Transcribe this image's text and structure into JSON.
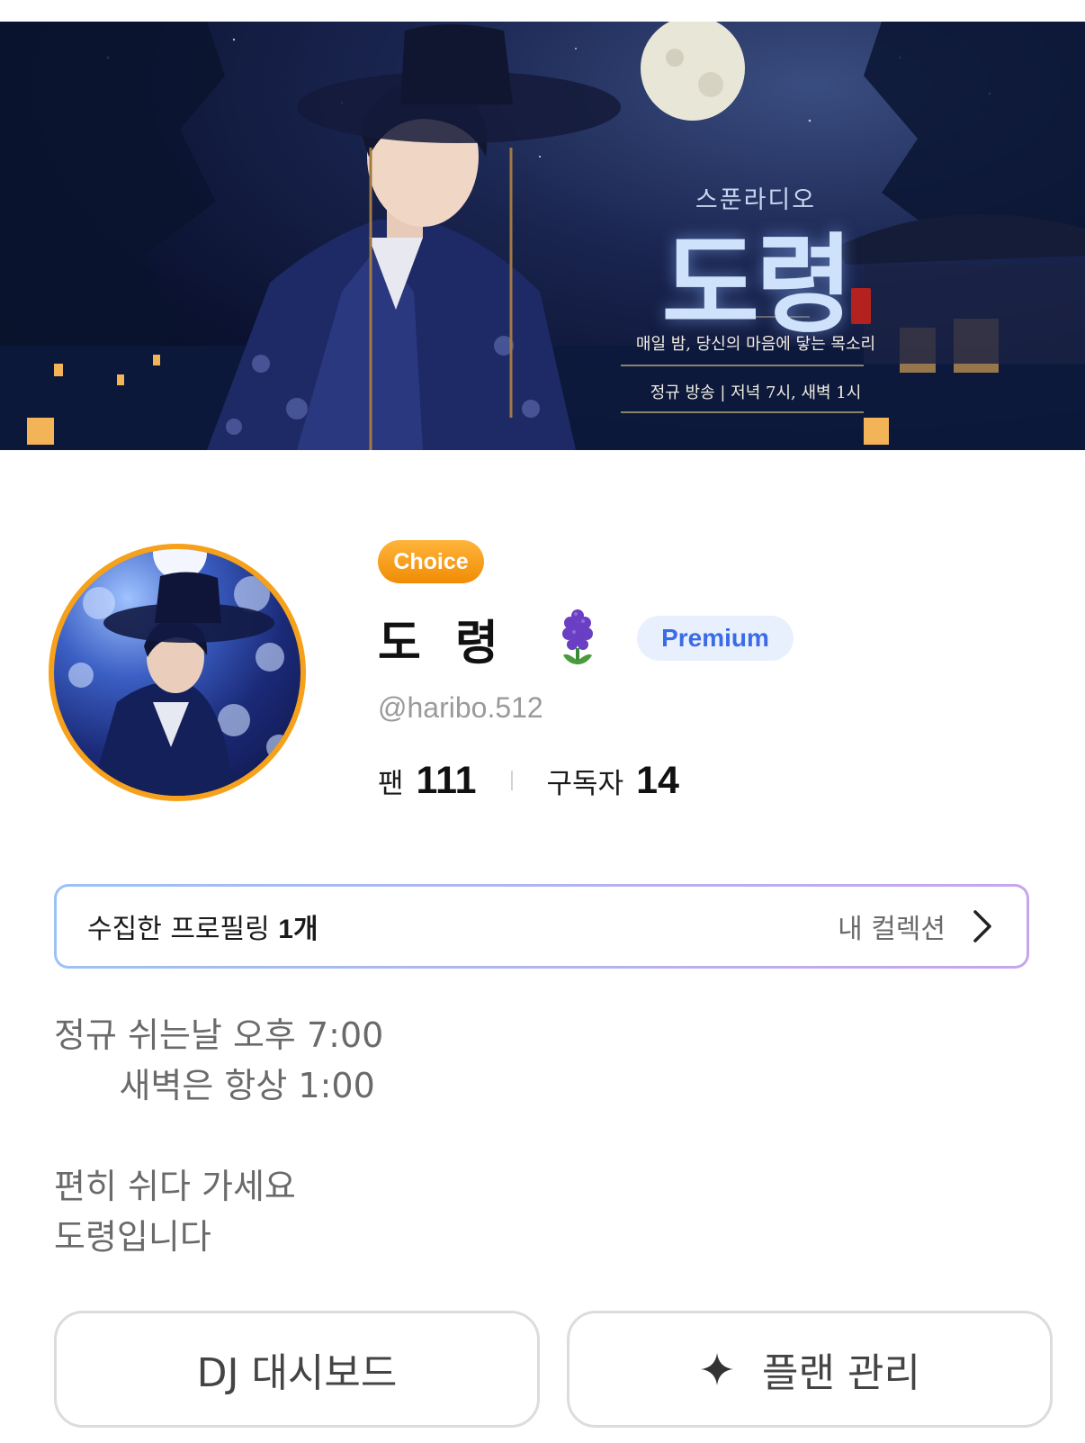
{
  "banner": {
    "subtitle": "스푼라디오",
    "title": "도령",
    "tagline": "매일 밤, 당신의 마음에 닿는 목소리",
    "schedule": "정규 방송 | 저녁 7시, 새벽 1시"
  },
  "profile": {
    "choice_badge": "Choice",
    "nickname": "도 령",
    "premium_badge": "Premium",
    "handle": "@haribo.512",
    "stats": [
      {
        "label": "팬",
        "value": "111"
      },
      {
        "label": "구독자",
        "value": "14"
      }
    ],
    "accent_color": "#f6a11c",
    "flower_icon": "hyacinth-icon"
  },
  "collection": {
    "label": "수집한 프로필링",
    "count": "1개",
    "link_label": "내 컬렉션"
  },
  "bio": {
    "text": "정규 쉬는날 오후 7:00\n      새벽은 항상 1:00\n\n편히 쉬다 가세요\n도령입니다"
  },
  "actions": {
    "dashboard_label": "DJ 대시보드",
    "plan_label": "플랜 관리"
  }
}
